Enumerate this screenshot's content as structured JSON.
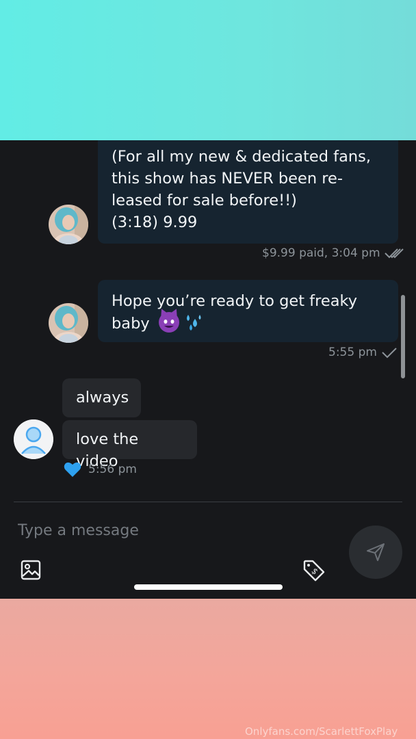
{
  "messages": {
    "m1": {
      "lines": [
        "(For all my new & dedicated fans,",
        "this show has NEVER been re-",
        "leased for sale before!!)",
        "(3:18) 9.99"
      ],
      "meta": "$9.99 paid, 3:04 pm"
    },
    "m2": {
      "line1": "Hope you’re ready to get freaky",
      "line2": "baby",
      "emojis": [
        "smiling-devil",
        "sweat-droplets"
      ],
      "meta": "5:55 pm"
    },
    "m3": {
      "text": "always"
    },
    "m4": {
      "text": "love the video",
      "meta": "5:56 pm"
    }
  },
  "composer": {
    "placeholder": "Type a message",
    "icons": [
      "image-icon",
      "price-tag-icon",
      "send-icon"
    ]
  },
  "watermark": "Onlyfans.com/ScarlettFoxPlay",
  "colors": {
    "chat_bg": "#17181b",
    "incoming_bubble": "#162430",
    "own_bubble": "#26282c",
    "like_heart": "#2ea1f0"
  }
}
